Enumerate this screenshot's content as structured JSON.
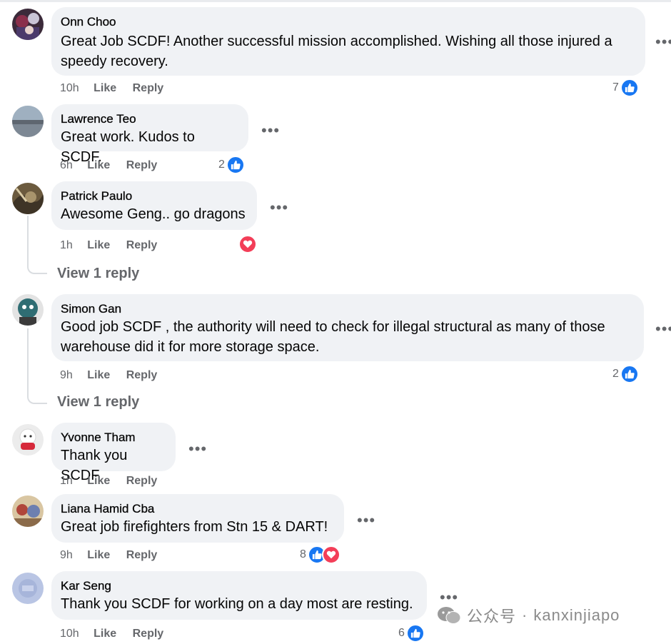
{
  "comments": [
    {
      "author": "Onn Choo",
      "text": "Great Job SCDF! Another successful mission accomplished. Wishing all those injured a speedy recovery.",
      "time": "10h",
      "like_label": "Like",
      "reply_label": "Reply",
      "reaction_count": "7",
      "more": "•••"
    },
    {
      "author": "Lawrence Teo",
      "text": "Great work. Kudos to SCDF.",
      "time": "6h",
      "like_label": "Like",
      "reply_label": "Reply",
      "reaction_count": "2",
      "more": "•••"
    },
    {
      "author": "Patrick Paulo",
      "text": "Awesome Geng.. go dragons",
      "time": "1h",
      "like_label": "Like",
      "reply_label": "Reply",
      "more": "•••",
      "view_reply": "View 1 reply"
    },
    {
      "author": "Simon Gan",
      "text": "Good job SCDF , the authority will need to check for illegal structural as many of those warehouse did it for more storage space.",
      "time": "9h",
      "like_label": "Like",
      "reply_label": "Reply",
      "reaction_count": "2",
      "more": "•••",
      "view_reply": "View 1 reply"
    },
    {
      "author": "Yvonne Tham",
      "text": "Thank you SCDF",
      "time": "1h",
      "like_label": "Like",
      "reply_label": "Reply",
      "more": "•••"
    },
    {
      "author": "Liana Hamid Cba",
      "text": "Great job firefighters from Stn 15 & DART!",
      "time": "9h",
      "like_label": "Like",
      "reply_label": "Reply",
      "reaction_count": "8",
      "more": "•••"
    },
    {
      "author": "Kar Seng",
      "text": "Thank you SCDF for working on a day most are resting.",
      "time": "10h",
      "like_label": "Like",
      "reply_label": "Reply",
      "reaction_count": "6",
      "more": "•••"
    }
  ],
  "watermark": {
    "label": "公众号",
    "separator": "·",
    "handle": "kanxinjiapo"
  },
  "colors": {
    "bubble": "#f0f2f5",
    "like_blue": "#1877f2",
    "love_red": "#f33e58",
    "meta_gray": "#65676b"
  }
}
